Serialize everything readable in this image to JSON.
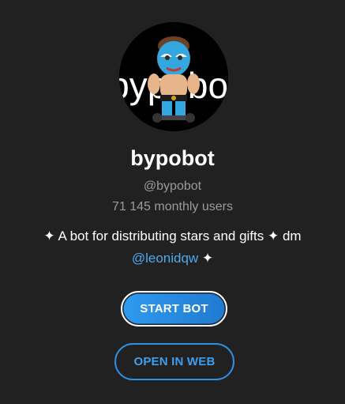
{
  "profile": {
    "avatar_text": "bypobot",
    "name": "bypobot",
    "handle": "@bypobot",
    "monthly_users": "71 145 monthly users"
  },
  "description": {
    "text": "✦ A bot for distributing stars and gifts ✦ dm",
    "mention": "@leonidqw",
    "suffix": " ✦"
  },
  "buttons": {
    "start_label": "START BOT",
    "open_web_label": "OPEN IN WEB"
  },
  "colors": {
    "background": "#212121",
    "accent": "#2f8fe0",
    "link": "#4da8ee"
  }
}
